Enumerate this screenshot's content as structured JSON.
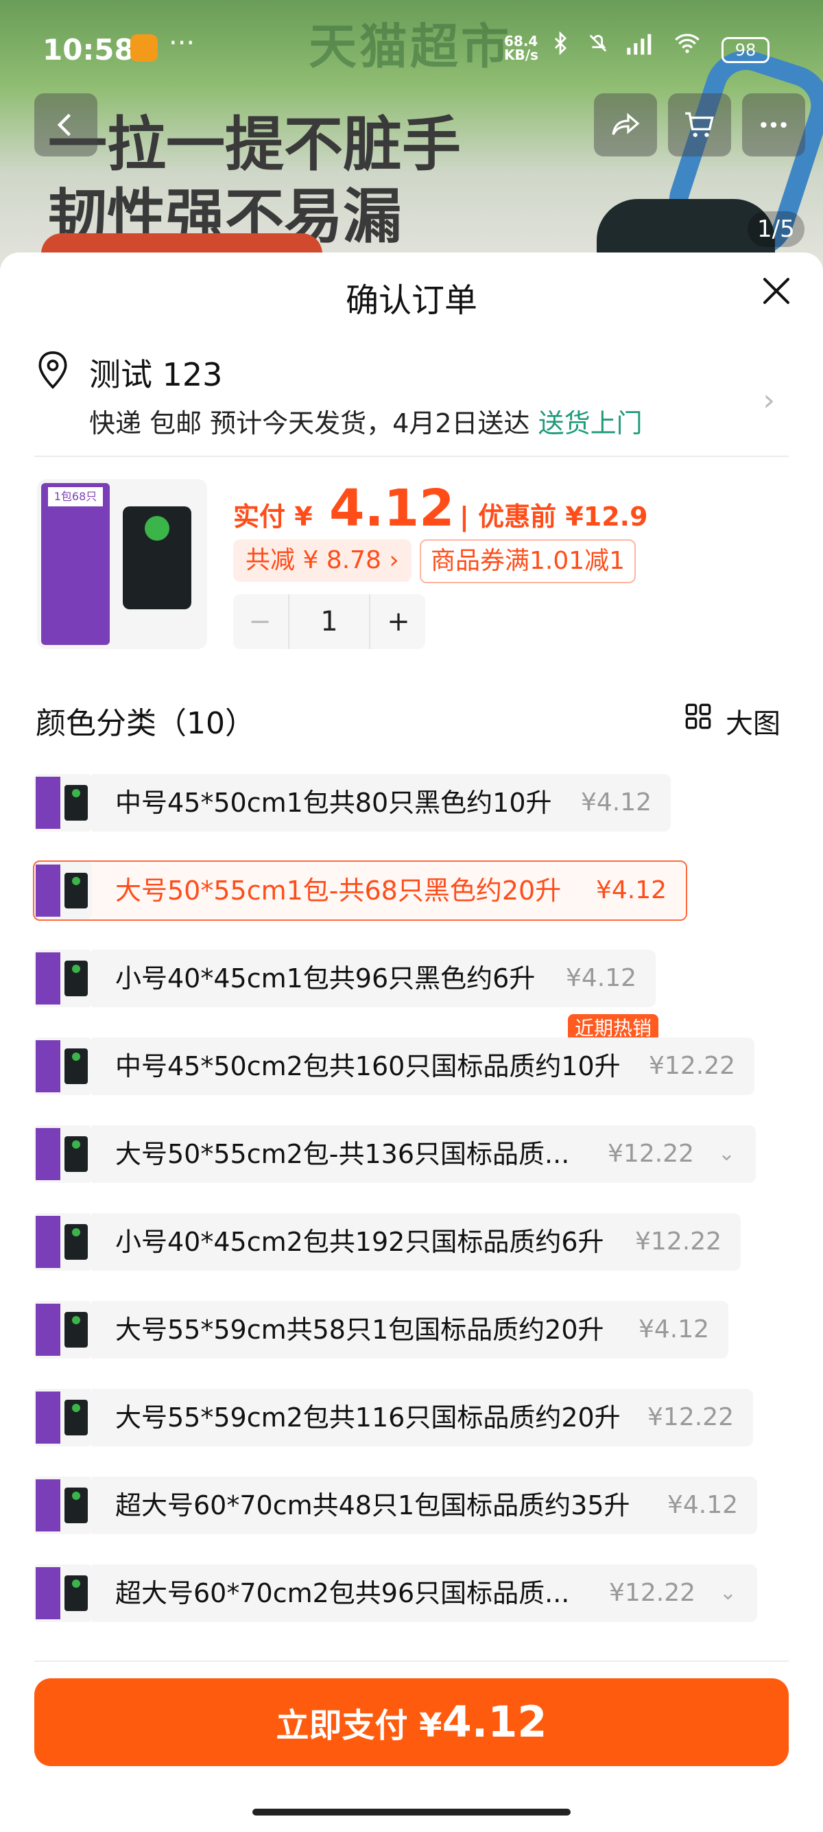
{
  "status_bar": {
    "time": "10:58",
    "network_rate": "68.4\nKB/s",
    "battery": "98"
  },
  "background": {
    "store_brand": "天猫超市",
    "headline_line1": "一拉一提不脏手",
    "headline_line2": "韧性强不易漏",
    "pager": "1/5"
  },
  "sheet": {
    "title": "确认订单",
    "address": {
      "name": "测试 123",
      "delivery_text": "快递 包邮 预计今天发货，4月2日送达",
      "delivery_tag": "送货上门"
    },
    "product": {
      "thumb_tag": "1包68只",
      "price_label": "实付 ¥",
      "price_value": "4.12",
      "price_before": "| 优惠前 ¥12.9",
      "discount_total": "共减 ¥ 8.78 ›",
      "coupon": "商品券满1.01减1",
      "quantity": "1",
      "minus": "−",
      "plus": "+"
    },
    "category_title": "颜色分类（10）",
    "big_view_label": "大图",
    "hot_badge": "近期热销",
    "options": [
      {
        "name": "中号45*50cm1包共80只黑色约10升",
        "price": "¥4.12",
        "selected": false
      },
      {
        "name": "大号50*55cm1包-共68只黑色约20升",
        "price": "¥4.12",
        "selected": true
      },
      {
        "name": "小号40*45cm1包共96只黑色约6升",
        "price": "¥4.12",
        "selected": false
      },
      {
        "name": "中号45*50cm2包共160只国标品质约10升",
        "price": "¥12.22",
        "selected": false
      },
      {
        "name": "大号50*55cm2包-共136只国标品质...",
        "price": "¥12.22",
        "selected": false,
        "expandable": true
      },
      {
        "name": "小号40*45cm2包共192只国标品质约6升",
        "price": "¥12.22",
        "selected": false
      },
      {
        "name": "大号55*59cm共58只1包国标品质约20升",
        "price": "¥4.12",
        "selected": false
      },
      {
        "name": "大号55*59cm2包共116只国标品质约20升",
        "price": "¥12.22",
        "selected": false
      },
      {
        "name": "超大号60*70cm共48只1包国标品质约35升",
        "price": "¥4.12",
        "selected": false
      },
      {
        "name": "超大号60*70cm2包共96只国标品质...",
        "price": "¥12.22",
        "selected": false,
        "expandable": true
      }
    ],
    "pay_button": {
      "label": "立即支付 ¥",
      "amount": "4.12"
    }
  },
  "colors": {
    "accent": "#ff5b0e",
    "accent_text": "#ff4d1a",
    "delivery_green": "#1f9a7a",
    "product_purple": "#7a3fb8"
  }
}
